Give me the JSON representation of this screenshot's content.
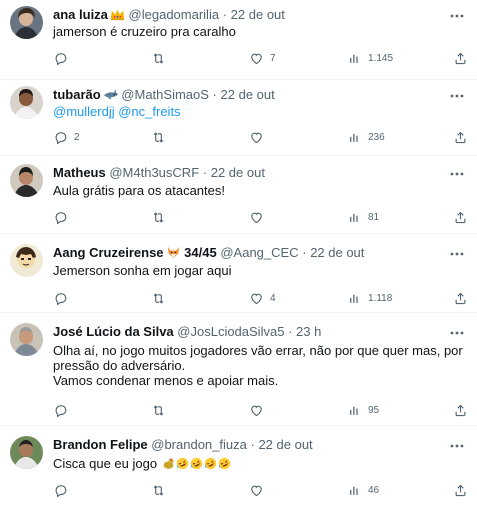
{
  "tweets": [
    {
      "name": "ana luiza",
      "name_emoji": "crown-icon",
      "handle": "@legadomarilia",
      "dot": "·",
      "time": "22 de out",
      "lines": [
        {
          "text": "jamerson é cruzeiro pra caralho"
        }
      ],
      "replies": "",
      "retweets": "",
      "likes": "7",
      "views": "1.145"
    },
    {
      "name": "tubarão",
      "name_emoji": "shark-icon",
      "handle": "@MathSimaoS",
      "dot": "·",
      "time": "22 de out",
      "mention_1": "@mullerdjj",
      "mention_2": "@nc_freits",
      "replies": "2",
      "retweets": "",
      "likes": "",
      "views": "236"
    },
    {
      "name": "Matheus",
      "handle": "@M4th3usCRF",
      "dot": "·",
      "time": "22 de out",
      "lines": [
        {
          "text": "Aula grátis para os atacantes!"
        }
      ],
      "replies": "",
      "retweets": "",
      "likes": "",
      "views": "81"
    },
    {
      "name": "Aang Cruzeirense",
      "name_emoji": "fox-icon",
      "name_suffix": "34/45",
      "handle": "@Aang_CEC",
      "dot": "·",
      "time": "22 de out",
      "lines": [
        {
          "text": "Jemerson sonha em jogar aqui"
        }
      ],
      "replies": "",
      "retweets": "",
      "likes": "4",
      "views": "1.118"
    },
    {
      "name": "José Lúcio da Silva",
      "handle": "@JosLciodaSilva5",
      "dot": "·",
      "time": "23 h",
      "lines": [
        {
          "text": "Olha aí, no jogo muitos jogadores vão errar, não por que quer mas, por"
        },
        {
          "text": "pressão do adversário."
        },
        {
          "text": "Vamos condenar menos e apoiar mais."
        }
      ],
      "replies": "",
      "retweets": "",
      "likes": "",
      "views": "95"
    },
    {
      "name": "Brandon Felipe",
      "handle": "@brandon_fiuza",
      "dot": "·",
      "time": "22 de out",
      "text": "Cisca que eu jogo",
      "text_emojis": [
        "chicken-icon",
        "rofl-icon",
        "rofl-icon",
        "rofl-icon",
        "rofl-icon"
      ],
      "replies": "",
      "retweets": "",
      "likes": "",
      "views": "46"
    }
  ],
  "colors": {
    "text": "#0f1419",
    "secondary": "#536471",
    "link": "#1d9bf0",
    "divider": "#eff3f4"
  }
}
